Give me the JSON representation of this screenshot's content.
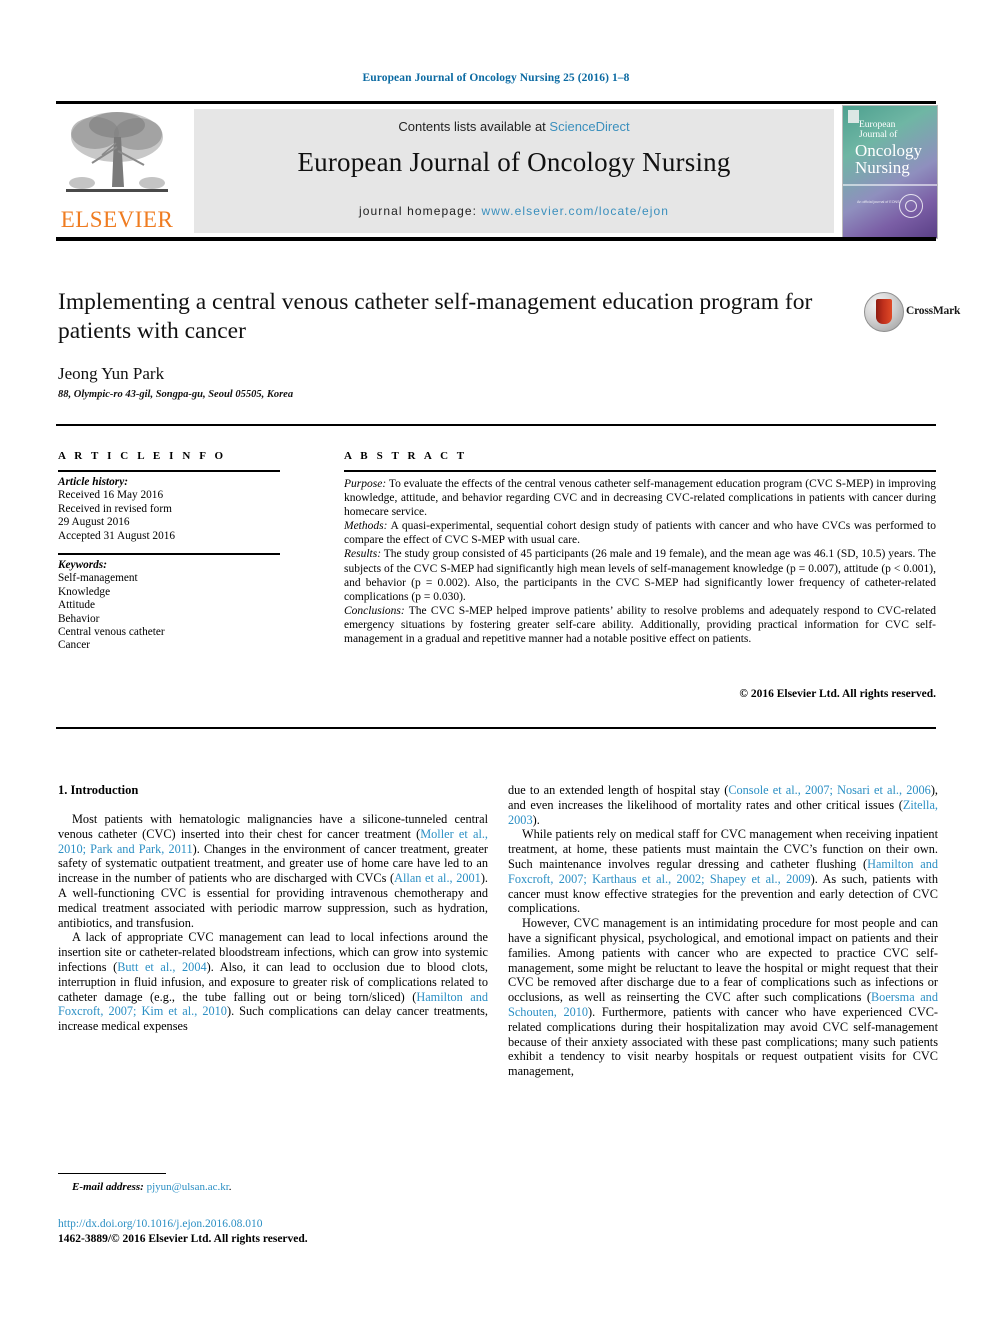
{
  "running_head": "European Journal of Oncology Nursing 25 (2016) 1–8",
  "masthead": {
    "publisher_logo_name": "elsevier-tree-logo",
    "publisher_wordmark": "ELSEVIER",
    "contents_prefix": "Contents lists available at ",
    "contents_link": "ScienceDirect",
    "journal_name": "European Journal of Oncology Nursing",
    "homepage_prefix": "journal homepage: ",
    "homepage_url": "www.elsevier.com/locate/ejon",
    "cover": {
      "line1": "European",
      "line2": "Journal of",
      "line3": "Oncology",
      "line4": "Nursing",
      "footnote": "An official journal of EONS"
    }
  },
  "article": {
    "title": "Implementing a central venous catheter self-management education program for patients with cancer",
    "crossmark_label": "CrossMark",
    "author": "Jeong Yun Park",
    "affiliation": "88, Olympic-ro 43-gil, Songpa-gu, Seoul 05505, Korea"
  },
  "article_info": {
    "heading": "A R T I C L E  I N F O",
    "history_label": "Article history:",
    "history": [
      "Received 16 May 2016",
      "Received in revised form",
      "29 August 2016",
      "Accepted 31 August 2016"
    ],
    "keywords_label": "Keywords:",
    "keywords": [
      "Self-management",
      "Knowledge",
      "Attitude",
      "Behavior",
      "Central venous catheter",
      "Cancer"
    ]
  },
  "abstract": {
    "heading": "A B S T R A C T",
    "purpose_label": "Purpose:",
    "purpose_text": " To evaluate the effects of the central venous catheter self-management education program (CVC S-MEP) in improving knowledge, attitude, and behavior regarding CVC and in decreasing CVC-related complications in patients with cancer during homecare service.",
    "methods_label": "Methods:",
    "methods_text": " A quasi-experimental, sequential cohort design study of patients with cancer and who have CVCs was performed to compare the effect of CVC S-MEP with usual care.",
    "results_label": "Results:",
    "results_text": " The study group consisted of 45 participants (26 male and 19 female), and the mean age was 46.1 (SD, 10.5) years. The subjects of the CVC S-MEP had significantly high mean levels of self-management knowledge (p = 0.007), attitude (p < 0.001), and behavior (p = 0.002). Also, the participants in the CVC S-MEP had significantly lower frequency of catheter-related complications (p = 0.030).",
    "conclusions_label": "Conclusions:",
    "conclusions_text": " The CVC S-MEP helped improve patients’ ability to resolve problems and adequately respond to CVC-related emergency situations by fostering greater self-care ability. Additionally, providing practical information for CVC self-management in a gradual and repetitive manner had a notable positive effect on patients.",
    "copyright": "© 2016 Elsevier Ltd. All rights reserved."
  },
  "body": {
    "section_number_title": "1. Introduction",
    "left_column": [
      {
        "parts": [
          {
            "t": "Most patients with hematologic malignancies have a silicone-tunneled central venous catheter (CVC) inserted into their chest for cancer treatment (",
            "ref": false
          },
          {
            "t": "Moller et al., 2010; Park and Park, 2011",
            "ref": true
          },
          {
            "t": "). Changes in the environment of cancer treatment, greater safety of systematic outpatient treatment, and greater use of home care have led to an increase in the number of patients who are discharged with CVCs (",
            "ref": false
          },
          {
            "t": "Allan et al., 2001",
            "ref": true
          },
          {
            "t": "). A well-functioning CVC is essential for providing intravenous chemotherapy and medical treatment associated with periodic marrow suppression, such as hydration, antibiotics, and transfusion.",
            "ref": false
          }
        ]
      },
      {
        "parts": [
          {
            "t": "A lack of appropriate CVC management can lead to local infections around the insertion site or catheter-related bloodstream infections, which can grow into systemic infections (",
            "ref": false
          },
          {
            "t": "Butt et al., 2004",
            "ref": true
          },
          {
            "t": "). Also, it can lead to occlusion due to blood clots, interruption in fluid infusion, and exposure to greater risk of complications related to catheter damage (e.g., the tube falling out or being torn/sliced) (",
            "ref": false
          },
          {
            "t": "Hamilton and Foxcroft, 2007; Kim et al., 2010",
            "ref": true
          },
          {
            "t": "). Such complications can delay cancer treatments, increase medical expenses",
            "ref": false
          }
        ]
      }
    ],
    "right_column": [
      {
        "parts": [
          {
            "t": "due to an extended length of hospital stay (",
            "ref": false
          },
          {
            "t": "Console et al., 2007; Nosari et al., 2006",
            "ref": true
          },
          {
            "t": "), and even increases the likelihood of mortality rates and other critical issues (",
            "ref": false
          },
          {
            "t": "Zitella, 2003",
            "ref": true
          },
          {
            "t": ").",
            "ref": false
          }
        ],
        "no_indent": true
      },
      {
        "parts": [
          {
            "t": "While patients rely on medical staff for CVC management when receiving inpatient treatment, at home, these patients must maintain the CVC’s function on their own. Such maintenance involves regular dressing and catheter flushing (",
            "ref": false
          },
          {
            "t": "Hamilton and Foxcroft, 2007; Karthaus et al., 2002; Shapey et al., 2009",
            "ref": true
          },
          {
            "t": "). As such, patients with cancer must know effective strategies for the prevention and early detection of CVC complications.",
            "ref": false
          }
        ]
      },
      {
        "parts": [
          {
            "t": "However, CVC management is an intimidating procedure for most people and can have a significant physical, psychological, and emotional impact on patients and their families. Among patients with cancer who are expected to practice CVC self-management, some might be reluctant to leave the hospital or might request that their CVC be removed after discharge due to a fear of complications such as infections or occlusions, as well as reinserting the CVC after such complications (",
            "ref": false
          },
          {
            "t": "Boersma and Schouten, 2010",
            "ref": true
          },
          {
            "t": "). Furthermore, patients with cancer who have experienced CVC-related complications during their hospitalization may avoid CVC self-management because of their anxiety associated with these past complications; many such patients exhibit a tendency to visit nearby hospitals or request outpatient visits for CVC management,",
            "ref": false
          }
        ]
      }
    ]
  },
  "footer": {
    "email_label": "E-mail address:",
    "email": "pjyun@ulsan.ac.kr",
    "email_suffix": ".",
    "doi": "http://dx.doi.org/10.1016/j.ejon.2016.08.010",
    "issn_line": "1462-3889/© 2016 Elsevier Ltd. All rights reserved."
  },
  "colors": {
    "link": "#2b8fc4",
    "runhead": "#0b6aa2",
    "elsevier_orange": "#ef7c21"
  }
}
